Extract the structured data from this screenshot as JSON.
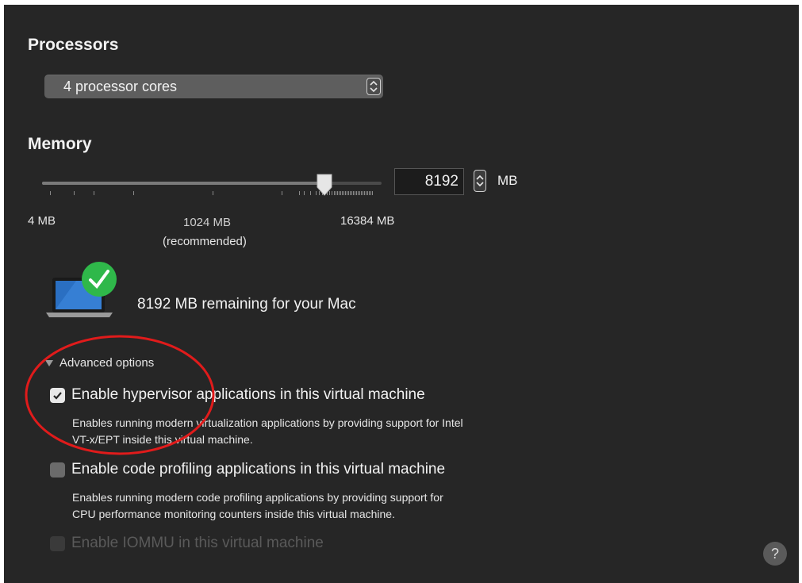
{
  "processors": {
    "heading": "Processors",
    "selected": "4 processor cores"
  },
  "memory": {
    "heading": "Memory",
    "value": "8192",
    "unit": "MB",
    "slider": {
      "min_mb": 4,
      "max_mb": 16384,
      "value_mb": 8192
    },
    "scale": {
      "min_label": "4 MB",
      "recommended_value": "1024 MB",
      "recommended_note": "(recommended)",
      "max_label": "16384 MB"
    }
  },
  "status": {
    "remaining": "8192 MB remaining for your Mac"
  },
  "advanced": {
    "label": "Advanced options",
    "options": [
      {
        "label": "Enable hypervisor applications in this virtual machine",
        "checked": true,
        "description_line1": "Enables running modern virtualization applications by providing support for Intel",
        "description_line2": "VT-x/EPT inside this virtual machine."
      },
      {
        "label": "Enable code profiling applications in this virtual machine",
        "checked": false,
        "description_line1": "Enables running modern code profiling applications by providing support for",
        "description_line2": "CPU performance monitoring counters inside this virtual machine."
      },
      {
        "label": "Enable IOMMU in this virtual machine",
        "checked": false,
        "disabled": true
      }
    ]
  },
  "help": {
    "glyph": "?"
  },
  "colors": {
    "background": "#262626",
    "text": "#f2f2f2",
    "check_ok": "#2fb84a",
    "annotation": "#e01b1b"
  }
}
